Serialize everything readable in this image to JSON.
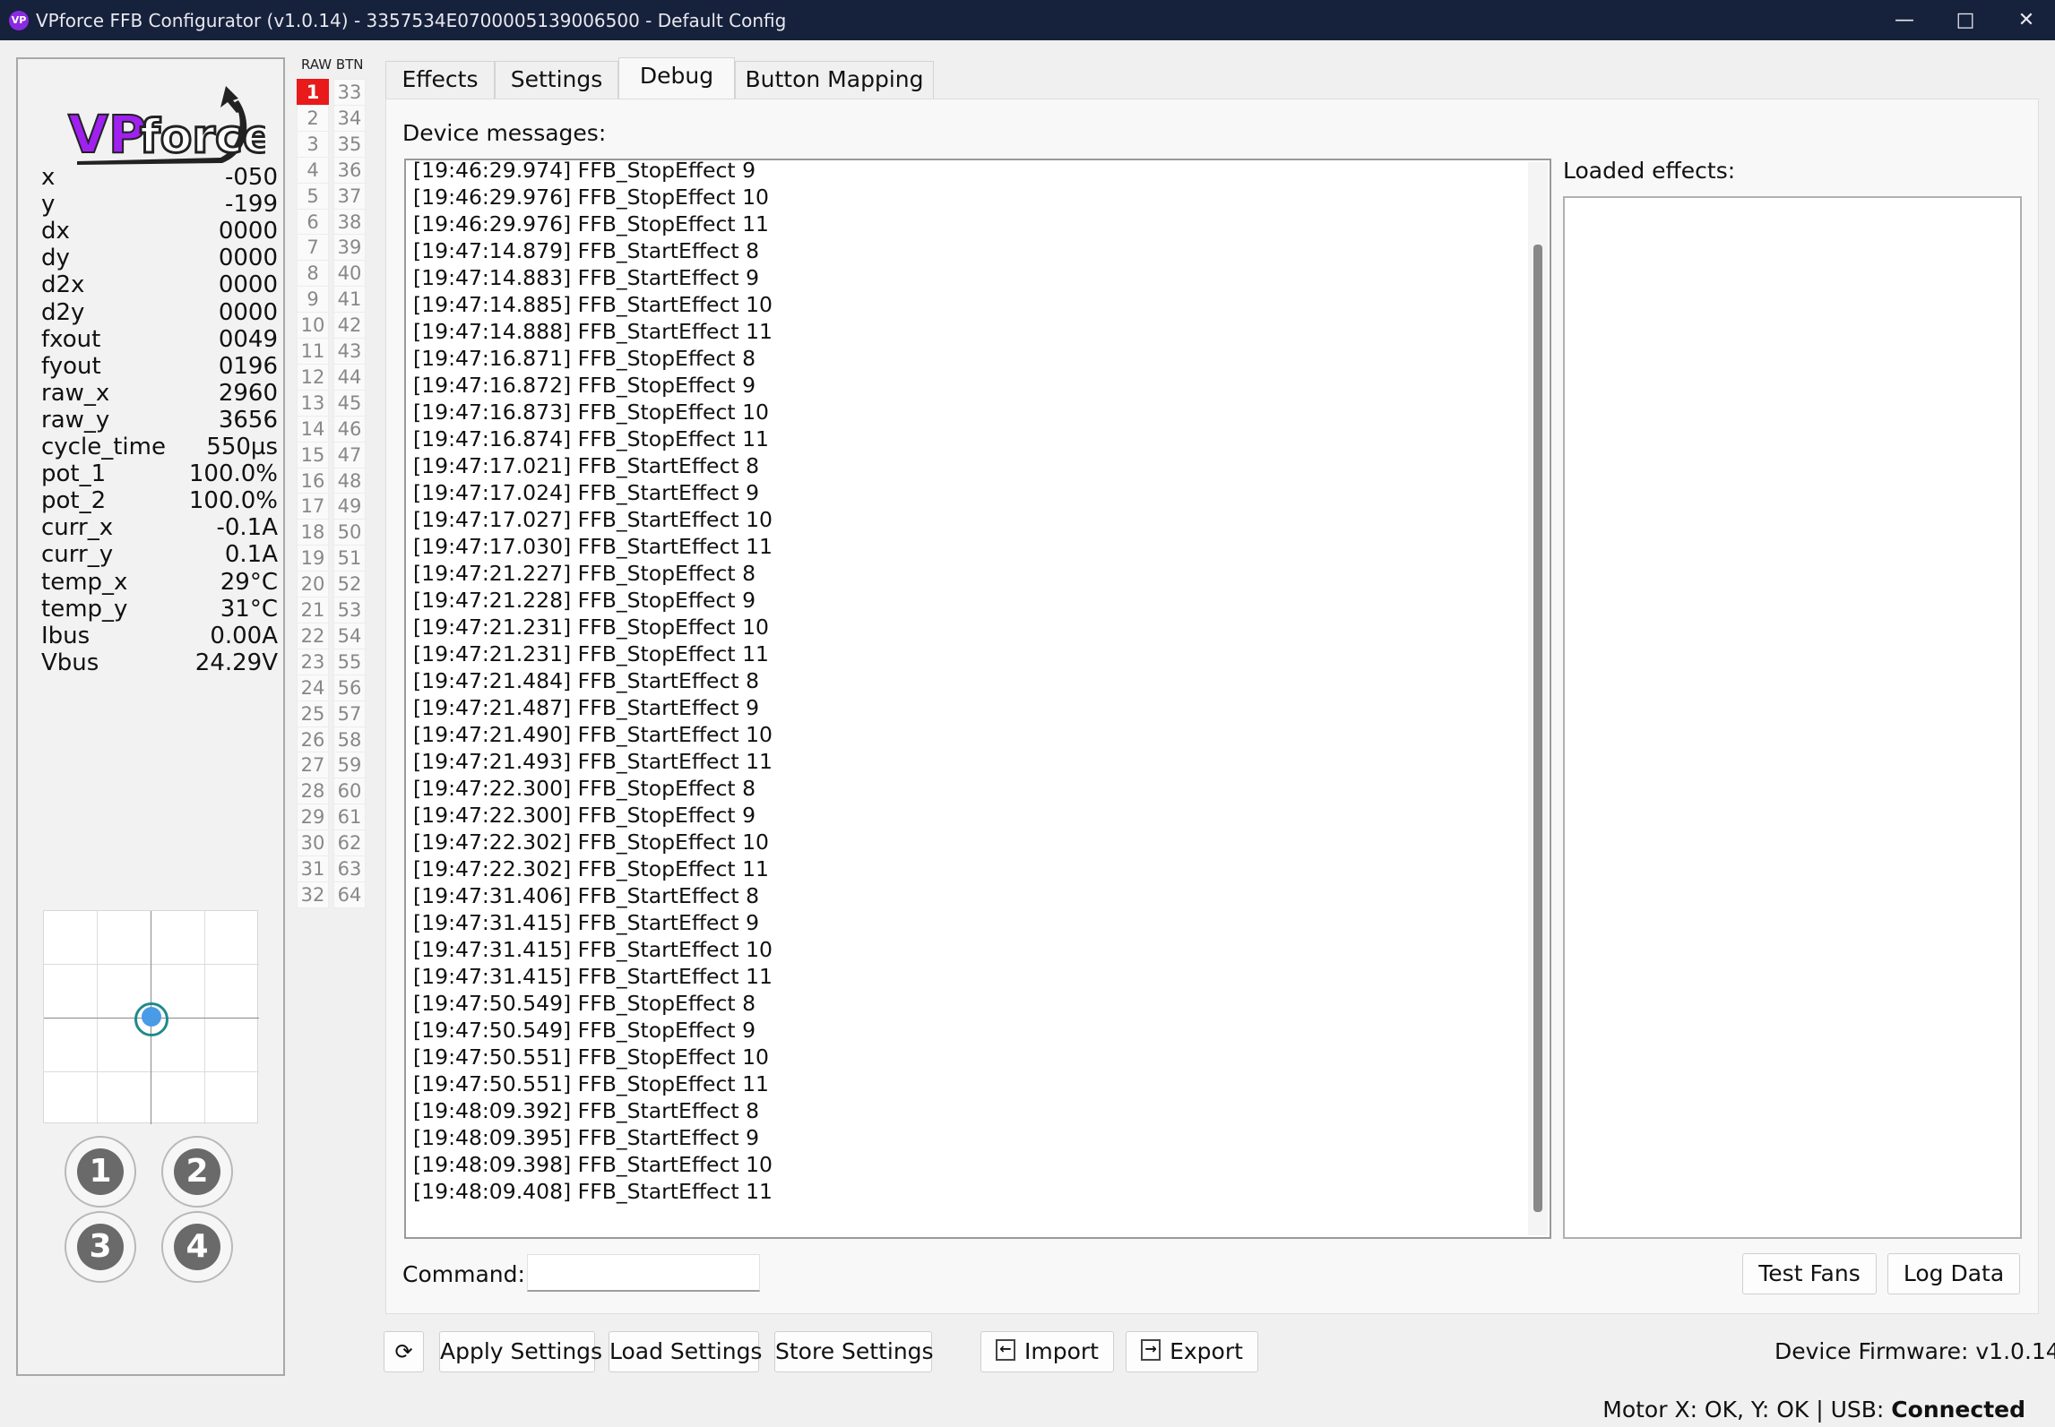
{
  "window": {
    "title": "VPforce FFB Configurator (v1.0.14) - 3357534E0700005139006500 - Default Config",
    "icon_text": "VP",
    "minimize": "—",
    "maximize": "□",
    "close": "✕"
  },
  "logo": {
    "text": "VPforce"
  },
  "stats": [
    {
      "label": "x",
      "value": "-050"
    },
    {
      "label": "y",
      "value": "-199"
    },
    {
      "label": "dx",
      "value": "0000"
    },
    {
      "label": "dy",
      "value": "0000"
    },
    {
      "label": "d2x",
      "value": "0000"
    },
    {
      "label": "d2y",
      "value": "0000"
    },
    {
      "label": "fxout",
      "value": "0049"
    },
    {
      "label": "fyout",
      "value": "0196"
    },
    {
      "label": "raw_x",
      "value": "2960"
    },
    {
      "label": "raw_y",
      "value": "3656"
    },
    {
      "label": "cycle_time",
      "value": "550µs"
    },
    {
      "label": "pot_1",
      "value": "100.0%"
    },
    {
      "label": "pot_2",
      "value": "100.0%"
    },
    {
      "label": "curr_x",
      "value": "-0.1A"
    },
    {
      "label": "curr_y",
      "value": "0.1A"
    },
    {
      "label": "temp_x",
      "value": "29°C"
    },
    {
      "label": "temp_y",
      "value": "31°C"
    },
    {
      "label": "Ibus",
      "value": "0.00A"
    },
    {
      "label": "Vbus",
      "value": "24.29V"
    }
  ],
  "pov_buttons": [
    "1",
    "2",
    "3",
    "4"
  ],
  "raw_buttons": {
    "header": "RAW BTN",
    "active": [
      1
    ],
    "count": 64
  },
  "tabs": [
    {
      "label": "Effects"
    },
    {
      "label": "Settings"
    },
    {
      "label": "Debug"
    },
    {
      "label": "Button Mapping"
    }
  ],
  "debug": {
    "device_messages_label": "Device messages:",
    "loaded_effects_label": "Loaded effects:",
    "command_label": "Command:",
    "command_value": "",
    "test_fans": "Test Fans",
    "log_data": "Log Data",
    "messages": [
      "[19:46:29.974] FFB_StopEffect 9",
      "[19:46:29.976] FFB_StopEffect 10",
      "[19:46:29.976] FFB_StopEffect 11",
      "[19:47:14.879] FFB_StartEffect 8",
      "[19:47:14.883] FFB_StartEffect 9",
      "[19:47:14.885] FFB_StartEffect 10",
      "[19:47:14.888] FFB_StartEffect 11",
      "[19:47:16.871] FFB_StopEffect 8",
      "[19:47:16.872] FFB_StopEffect 9",
      "[19:47:16.873] FFB_StopEffect 10",
      "[19:47:16.874] FFB_StopEffect 11",
      "[19:47:17.021] FFB_StartEffect 8",
      "[19:47:17.024] FFB_StartEffect 9",
      "[19:47:17.027] FFB_StartEffect 10",
      "[19:47:17.030] FFB_StartEffect 11",
      "[19:47:21.227] FFB_StopEffect 8",
      "[19:47:21.228] FFB_StopEffect 9",
      "[19:47:21.231] FFB_StopEffect 10",
      "[19:47:21.231] FFB_StopEffect 11",
      "[19:47:21.484] FFB_StartEffect 8",
      "[19:47:21.487] FFB_StartEffect 9",
      "[19:47:21.490] FFB_StartEffect 10",
      "[19:47:21.493] FFB_StartEffect 11",
      "[19:47:22.300] FFB_StopEffect 8",
      "[19:47:22.300] FFB_StopEffect 9",
      "[19:47:22.302] FFB_StopEffect 10",
      "[19:47:22.302] FFB_StopEffect 11",
      "[19:47:31.406] FFB_StartEffect 8",
      "[19:47:31.415] FFB_StartEffect 9",
      "[19:47:31.415] FFB_StartEffect 10",
      "[19:47:31.415] FFB_StartEffect 11",
      "[19:47:50.549] FFB_StopEffect 8",
      "[19:47:50.549] FFB_StopEffect 9",
      "[19:47:50.551] FFB_StopEffect 10",
      "[19:47:50.551] FFB_StopEffect 11",
      "[19:48:09.392] FFB_StartEffect 8",
      "[19:48:09.395] FFB_StartEffect 9",
      "[19:48:09.398] FFB_StartEffect 10",
      "[19:48:09.408] FFB_StartEffect 11"
    ]
  },
  "toolbar": {
    "refresh_icon": "⟳",
    "apply": "Apply Settings",
    "load": "Load Settings",
    "store": "Store Settings",
    "import": "Import",
    "export": "Export",
    "import_icon": "import-icon",
    "export_icon": "export-icon"
  },
  "firmware": "Device Firmware:  v1.0.14",
  "status": {
    "motors": "Motor X: OK, Y: OK | USB: ",
    "connection": "Connected"
  },
  "colors": {
    "titlebar": "#16213c",
    "active_button": "#e81a1a",
    "logo_purple": "#a020f0"
  }
}
